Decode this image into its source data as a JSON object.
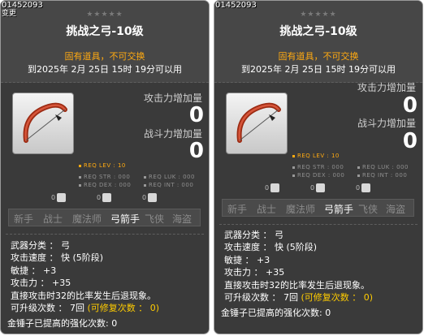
{
  "tooltips": [
    {
      "item_id": "01452093",
      "sub_label": "变更",
      "stars": "★★★★★",
      "title": "挑战之弓-10级",
      "untradeable": "固有道具，不可交换",
      "expiry": "到2025年 2月 25日 15时 19分可以用",
      "attack_increase_label": "攻击力增加量",
      "attack_increase_value": "0",
      "battle_increase_label": "战斗力增加量",
      "battle_increase_value": "0",
      "req_lev": "REQ LEV :   10",
      "req_str": "REQ STR : 000",
      "req_luk": "REQ LUK : 000",
      "req_dex": "REQ DEX : 000",
      "req_int": "REQ INT : 000",
      "job_icons": [
        "0",
        "0",
        "0"
      ],
      "classes": [
        "新手",
        "战士",
        "魔法师",
        "弓箭手",
        "飞侠",
        "海盗"
      ],
      "active_class": "弓箭手",
      "weapon_type": "武器分类 ： 弓",
      "attack_speed": "攻击速度 ： 快 (5阶段)",
      "agility": "敏捷 ： +3",
      "attack": "攻击力 ： +35",
      "knockback": "直接攻击时32的比率发生后退现象。",
      "upgrades_prefix": "可升级次数 ： 7回",
      "upgrades_suffix": " (可修复次数 ： 0)",
      "enhance_count": "金锤子已提高的强化次数: 0"
    },
    {
      "item_id": "01452093",
      "stars": "★★★★★",
      "title": "挑战之弓-10级",
      "untradeable": "固有道具，不可交换",
      "expiry": "到2025年 2月 25日 15时 19分可以用",
      "attack_increase_label": "攻击力增加量",
      "attack_increase_value": "0",
      "battle_increase_label": "战斗力增加量",
      "battle_increase_value": "0",
      "req_lev": "REQ LEV :   10",
      "req_str": "REQ STR : 000",
      "req_luk": "REQ LUK : 000",
      "req_dex": "REQ DEX : 000",
      "req_int": "REQ INT : 000",
      "job_icons": [
        "0",
        "0",
        "0"
      ],
      "classes": [
        "新手",
        "战士",
        "魔法师",
        "弓箭手",
        "飞侠",
        "海盗"
      ],
      "active_class": "弓箭手",
      "weapon_type": "武器分类 ： 弓",
      "attack_speed": "攻击速度 ： 快 (5阶段)",
      "agility": "敏捷 ： +3",
      "attack": "攻击力 ： +35",
      "knockback": "直接攻击时32的比率发生后退现象。",
      "upgrades_prefix": "可升级次数 ： 7回",
      "upgrades_suffix": " (可修复次数 ： 0)",
      "enhance_count": "金锤子已提高的强化次数: 0"
    }
  ]
}
